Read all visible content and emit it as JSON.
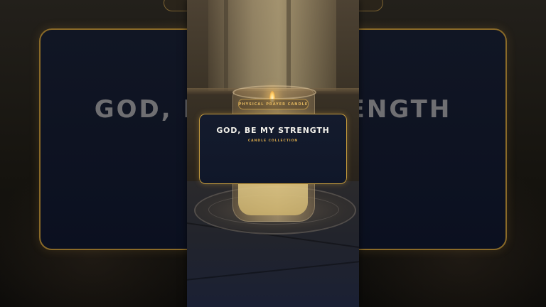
{
  "video": {
    "side_title": "GOD, BE MY STRENGTH"
  },
  "scene": {
    "candle_label": "PHYSICAL PRAYER CANDLE"
  },
  "card": {
    "title": "GOD, BE MY STRENGTH",
    "subtitle": "CANDLE COLLECTION"
  },
  "colors": {
    "accent_gold": "#c49a3c",
    "card_bg": "#131a2c",
    "title_text": "#f2f0ea",
    "subtitle_text": "#d9a94a"
  }
}
